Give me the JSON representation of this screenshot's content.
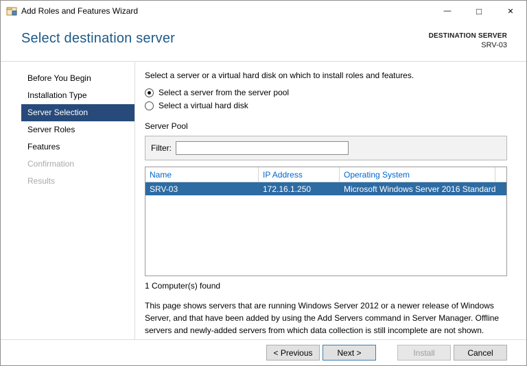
{
  "window": {
    "title": "Add Roles and Features Wizard",
    "controls": {
      "minimize": "—",
      "maximize": "□",
      "close": "✕"
    }
  },
  "header": {
    "title": "Select destination server",
    "destination_label": "DESTINATION SERVER",
    "destination_server": "SRV-03"
  },
  "sidebar": {
    "items": [
      {
        "label": "Before You Begin",
        "state": "normal"
      },
      {
        "label": "Installation Type",
        "state": "normal"
      },
      {
        "label": "Server Selection",
        "state": "selected"
      },
      {
        "label": "Server Roles",
        "state": "normal"
      },
      {
        "label": "Features",
        "state": "normal"
      },
      {
        "label": "Confirmation",
        "state": "disabled"
      },
      {
        "label": "Results",
        "state": "disabled"
      }
    ]
  },
  "content": {
    "intro": "Select a server or a virtual hard disk on which to install roles and features.",
    "radio_server_pool": "Select a server from the server pool",
    "radio_vhd": "Select a virtual hard disk",
    "server_pool_label": "Server Pool",
    "filter_label": "Filter:",
    "filter_value": "",
    "table": {
      "columns": [
        "Name",
        "IP Address",
        "Operating System"
      ],
      "rows": [
        {
          "name": "SRV-03",
          "ip": "172.16.1.250",
          "os": "Microsoft Windows Server 2016 Standard",
          "selected": true
        }
      ]
    },
    "found_text": "1 Computer(s) found",
    "note": "This page shows servers that are running Windows Server 2012 or a newer release of Windows Server, and that have been added by using the Add Servers command in Server Manager. Offline servers and newly-added servers from which data collection is still incomplete are not shown."
  },
  "footer": {
    "previous": "< Previous",
    "next": "Next >",
    "install": "Install",
    "cancel": "Cancel"
  },
  "colors": {
    "header_title": "#1d5987",
    "nav_selected_bg": "#274a7a",
    "row_selected_bg": "#2d6ba3",
    "table_header_text": "#0066cc"
  }
}
